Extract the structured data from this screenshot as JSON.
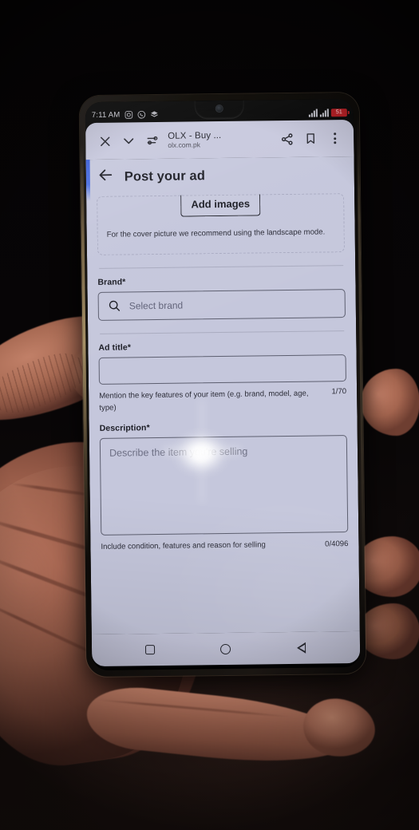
{
  "status_bar": {
    "time": "7:11 AM",
    "notification_icons": [
      "instagram-icon",
      "whatsapp-icon",
      "layers-icon"
    ],
    "signal_label": "dual-sim-signal",
    "battery_text": "51"
  },
  "browser_toolbar": {
    "close_label": "close-icon",
    "collapse_label": "chevron-down-icon",
    "site_settings_label": "site-settings-icon",
    "title": "OLX - Buy ...",
    "url": "olx.com.pk",
    "share_label": "share-icon",
    "bookmark_label": "bookmark-icon",
    "menu_label": "more-options-icon"
  },
  "page": {
    "back_label": "back-arrow-icon",
    "title": "Post your ad",
    "image_section": {
      "add_images_label": "Add images",
      "cover_note": "For the cover picture we recommend using the landscape mode."
    },
    "brand_field": {
      "label": "Brand",
      "required_mark": "*",
      "search_icon": "search-icon",
      "placeholder": "Select brand",
      "value": ""
    },
    "ad_title_field": {
      "label": "Ad title",
      "required_mark": "*",
      "placeholder": "",
      "value": "",
      "helper": "Mention the key features of your item (e.g. brand, model, age, type)",
      "counter": "1/70"
    },
    "description_field": {
      "label": "Description",
      "required_mark": "*",
      "placeholder": "Describe the item you're selling",
      "value": "",
      "helper": "Include condition, features and reason for selling",
      "counter": "0/4096"
    }
  },
  "nav_bar": {
    "recents_label": "recent-apps-icon",
    "home_label": "home-icon",
    "back_label": "back-icon"
  },
  "colors": {
    "screen_bg": "#c5c7dc",
    "toolbar_bg": "#c7c8dd",
    "text_primary": "#1b1c24",
    "text_secondary": "#2c2d38",
    "placeholder": "#62647a",
    "border": "#5d5f70",
    "battery_red": "#b4151b",
    "edge_blue": "#3a5fd9"
  }
}
